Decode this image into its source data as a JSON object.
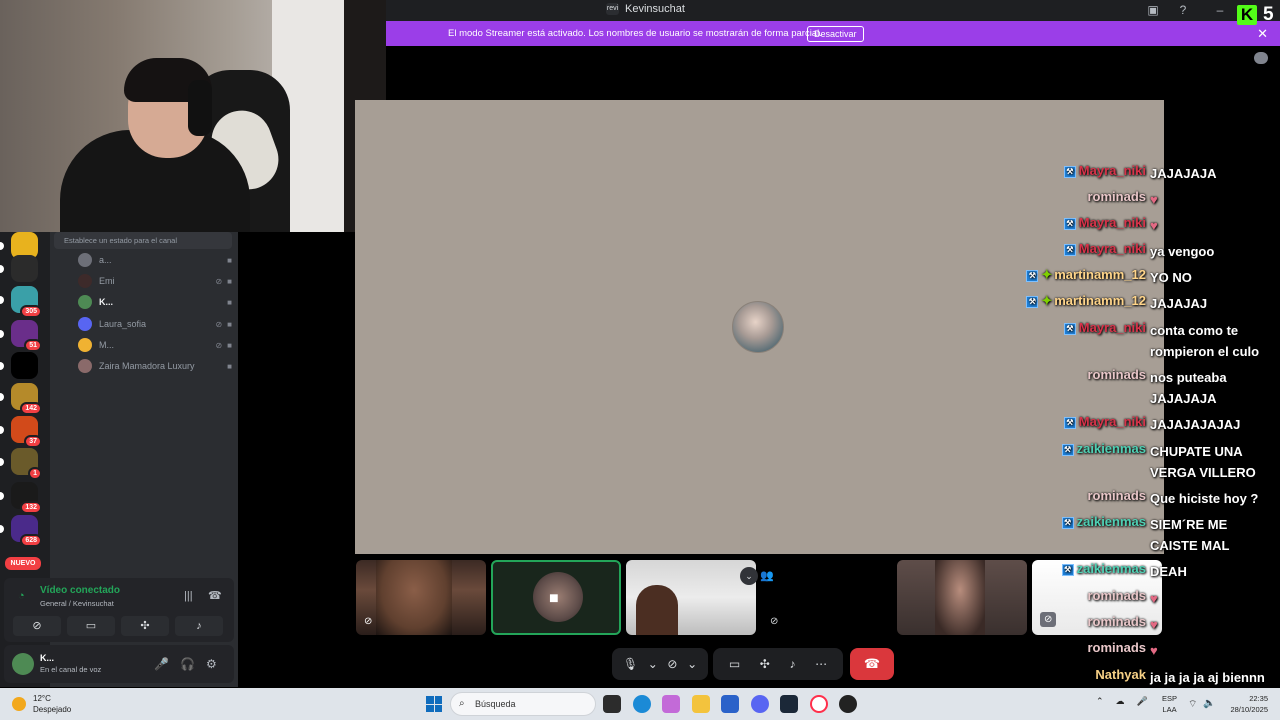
{
  "titlebar": {
    "server_icon": "revi",
    "title": "Kevinsuchat"
  },
  "banner": {
    "message": "El modo Streamer está activado. Los nombres de usuario se mostrarán de forma parcial.",
    "button": "Desactivar",
    "close": "✕"
  },
  "overlay": {
    "kick_number": "5",
    "kick_letter": "K"
  },
  "servers": [
    {
      "badge": ""
    },
    {
      "badge": ""
    },
    {
      "badge": "305"
    },
    {
      "badge": "51"
    },
    {
      "badge": ""
    },
    {
      "badge": "142"
    },
    {
      "badge": "37"
    },
    {
      "badge": "1"
    },
    {
      "badge": "132"
    },
    {
      "badge": "628"
    }
  ],
  "server_new": "NUEVO",
  "channel": {
    "status_placeholder": "Establece un estado para el canal",
    "members": [
      {
        "name": "a...",
        "bold": false
      },
      {
        "name": "Emi",
        "bold": false
      },
      {
        "name": "K...",
        "bold": true
      },
      {
        "name": "Laura_sofia",
        "bold": false
      },
      {
        "name": "M...",
        "bold": false
      },
      {
        "name": "Zaira Mamadora Luxury",
        "bold": false
      }
    ]
  },
  "voice": {
    "status": "Vídeo conectado",
    "channel_path": "General / Kevinsuchat"
  },
  "user": {
    "name": "K...",
    "status": "En el canal de voz"
  },
  "chat": [
    {
      "user": "Mayra_niki",
      "color": "red",
      "badge": true,
      "spark": false,
      "msg": "JAJAJAJA",
      "heart": false
    },
    {
      "user": "rominads",
      "color": "pink",
      "badge": false,
      "spark": false,
      "msg": "",
      "heart": true
    },
    {
      "user": "Mayra_niki",
      "color": "red",
      "badge": true,
      "spark": false,
      "msg": "",
      "heart": true
    },
    {
      "user": "Mayra_niki",
      "color": "red",
      "badge": true,
      "spark": false,
      "msg": "ya vengoo",
      "heart": false
    },
    {
      "user": "martinamm_12",
      "color": "yellow",
      "badge": true,
      "spark": true,
      "msg": "YO NO",
      "heart": false
    },
    {
      "user": "martinamm_12",
      "color": "yellow",
      "badge": true,
      "spark": true,
      "msg": "JAJAJAJ",
      "heart": false
    },
    {
      "user": "Mayra_niki",
      "color": "red",
      "badge": true,
      "spark": false,
      "msg": "conta como te rompieron el culo",
      "heart": false
    },
    {
      "user": "rominads",
      "color": "pink",
      "badge": false,
      "spark": false,
      "msg": "nos puteaba JAJAJAJA",
      "heart": false
    },
    {
      "user": "Mayra_niki",
      "color": "red",
      "badge": true,
      "spark": false,
      "msg": "JAJAJAJAJAJ",
      "heart": false
    },
    {
      "user": "zaikienmas",
      "color": "teal",
      "badge": true,
      "spark": false,
      "msg": "CHUPATE UNA VERGA VILLERO",
      "heart": false
    },
    {
      "user": "rominads",
      "color": "pink",
      "badge": false,
      "spark": false,
      "msg": "Que hiciste hoy ?",
      "heart": false
    },
    {
      "user": "zaikienmas",
      "color": "teal",
      "badge": true,
      "spark": false,
      "msg": "SIEM´RE ME CAISTE MAL",
      "heart": false
    },
    {
      "user": "zaikienmas",
      "color": "teal",
      "badge": true,
      "spark": false,
      "msg": "DEAH",
      "heart": false
    },
    {
      "user": "rominads",
      "color": "pink",
      "badge": false,
      "spark": false,
      "msg": "",
      "heart": true
    },
    {
      "user": "rominads",
      "color": "pink",
      "badge": false,
      "spark": false,
      "msg": "",
      "heart": true
    },
    {
      "user": "rominads",
      "color": "pink",
      "badge": false,
      "spark": false,
      "msg": "",
      "heart": true
    },
    {
      "user": "Nathyak",
      "color": "gold",
      "badge": false,
      "spark": false,
      "msg": "ja ja ja ja aj biennn",
      "heart": false
    }
  ],
  "taskbar": {
    "temp": "12°C",
    "weather": "Despejado",
    "search": "Búsqueda",
    "lang1": "ESP",
    "lang2": "LAA",
    "time": "22:35",
    "date": "28/10/2025"
  }
}
